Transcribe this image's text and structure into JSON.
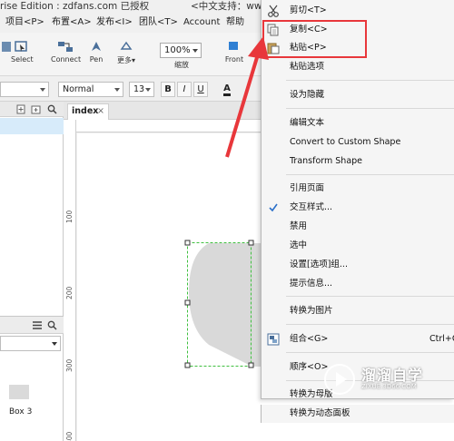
{
  "title_bar": {
    "left": "rise Edition : zdfans.com 已授权",
    "right": "<中文支持：www.axure.com"
  },
  "menu_bar": {
    "items": [
      "项目<P>",
      "布置<A>",
      "发布<I>",
      "团队<T>",
      "Account",
      "帮助"
    ]
  },
  "toolbar": {
    "buttons": [
      "Select",
      "Connect",
      "Pen",
      "更多▾",
      "缩放",
      "Front"
    ],
    "zoom_value": "100%"
  },
  "format_bar": {
    "style_value": "Normal",
    "size_value": "13",
    "bold": "B",
    "italic": "I",
    "underline": "U",
    "font_color": "A"
  },
  "left_panel": {
    "widget_label": "Box 3"
  },
  "canvas": {
    "tab_label": "index",
    "tab_close": "×",
    "ruler_marks": [
      "100",
      "200",
      "300",
      "400"
    ]
  },
  "context_menu": {
    "items": [
      {
        "label": "剪切<T>",
        "icon": "scissors-icon"
      },
      {
        "label": "复制<C>",
        "icon": "copy-icon"
      },
      {
        "label": "粘贴<P>",
        "icon": "paste-icon"
      },
      {
        "label": "粘贴选项"
      },
      {
        "label": "设为隐藏"
      },
      {
        "label": "编辑文本"
      },
      {
        "label": "Convert to Custom Shape"
      },
      {
        "label": "Transform Shape"
      },
      {
        "label": "引用页面"
      },
      {
        "label": "交互样式...",
        "icon": "checkmark-icon"
      },
      {
        "label": "禁用"
      },
      {
        "label": "选中"
      },
      {
        "label": "设置[选项]组..."
      },
      {
        "label": "提示信息..."
      },
      {
        "label": "转换为图片"
      },
      {
        "label": "组合<G>",
        "icon": "group-icon",
        "shortcut": "Ctrl+G"
      },
      {
        "label": "顺序<O>"
      },
      {
        "label": "转换为母版"
      },
      {
        "label": "转换为动态面板"
      }
    ]
  },
  "watermark": {
    "title": "溜溜自学",
    "subtitle": "ZIXUE.3D66.COM"
  },
  "colors": {
    "highlight": "#e8373b",
    "selection": "#d7ebfa",
    "shape_fill": "#d9d9d9",
    "check": "#2a6fc9"
  }
}
